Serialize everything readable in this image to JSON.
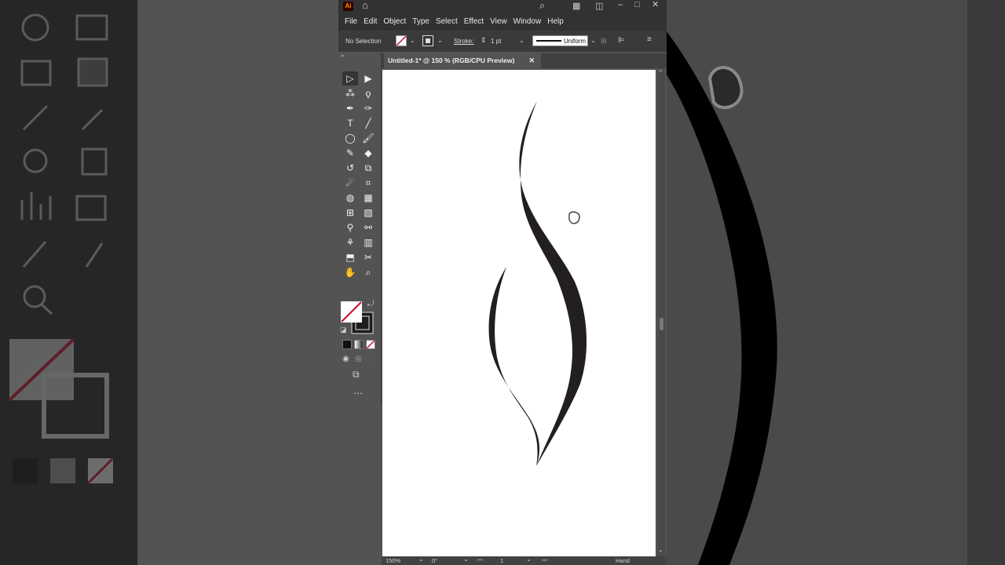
{
  "app": {
    "logo_text": "Ai"
  },
  "menu": [
    "File",
    "Edit",
    "Object",
    "Type",
    "Select",
    "Effect",
    "View",
    "Window",
    "Help"
  ],
  "control_bar": {
    "selection": "No Selection",
    "stroke_label": "Stroke:",
    "stroke_weight": "1 pt",
    "profile": "Uniform"
  },
  "document_tab": {
    "title": "Untitled-1* @ 150 % (RGB/CPU Preview)",
    "close": "✕"
  },
  "status_bar": {
    "zoom": "150%",
    "rotation": "0°",
    "artboard": "1",
    "tool": "Hand"
  },
  "toolbox": {
    "tools": [
      {
        "name": "selection-tool-icon",
        "glyph": "▷"
      },
      {
        "name": "direct-selection-tool-icon",
        "glyph": "▶"
      },
      {
        "name": "magic-wand-tool-icon",
        "glyph": "⁂"
      },
      {
        "name": "lasso-tool-icon",
        "glyph": "ϙ"
      },
      {
        "name": "pen-tool-icon",
        "glyph": "✒"
      },
      {
        "name": "curvature-tool-icon",
        "glyph": "✑"
      },
      {
        "name": "type-tool-icon",
        "glyph": "T"
      },
      {
        "name": "line-tool-icon",
        "glyph": "╱"
      },
      {
        "name": "ellipse-tool-icon",
        "glyph": "◯"
      },
      {
        "name": "paintbrush-tool-icon",
        "glyph": "🖌"
      },
      {
        "name": "shaper-tool-icon",
        "glyph": "✎"
      },
      {
        "name": "eraser-tool-icon",
        "glyph": "◆"
      },
      {
        "name": "rotate-tool-icon",
        "glyph": "↺"
      },
      {
        "name": "scale-tool-icon",
        "glyph": "⧉"
      },
      {
        "name": "warp-tool-icon",
        "glyph": "☄"
      },
      {
        "name": "free-transform-tool-icon",
        "glyph": "⌗"
      },
      {
        "name": "shape-builder-tool-icon",
        "glyph": "◍"
      },
      {
        "name": "perspective-grid-tool-icon",
        "glyph": "▦"
      },
      {
        "name": "mesh-tool-icon",
        "glyph": "⊞"
      },
      {
        "name": "gradient-tool-icon",
        "glyph": "▧"
      },
      {
        "name": "eyedropper-tool-icon",
        "glyph": "⚲"
      },
      {
        "name": "blend-tool-icon",
        "glyph": "⚯"
      },
      {
        "name": "symbol-sprayer-tool-icon",
        "glyph": "⚘"
      },
      {
        "name": "column-graph-tool-icon",
        "glyph": "▥"
      },
      {
        "name": "artboard-tool-icon",
        "glyph": "⬒"
      },
      {
        "name": "slice-tool-icon",
        "glyph": "✂"
      },
      {
        "name": "hand-tool-icon",
        "glyph": "✋"
      },
      {
        "name": "zoom-tool-icon",
        "glyph": "⌕"
      }
    ]
  },
  "colors": {
    "accent_red": "#c8102e",
    "stroke": "#231f20",
    "artboard": "#ffffff"
  }
}
